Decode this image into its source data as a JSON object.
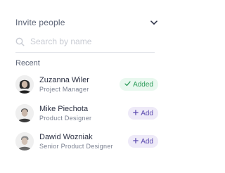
{
  "header": {
    "title": "Invite people",
    "toggle_icon": "chevron-down-icon"
  },
  "search": {
    "placeholder": "Search by name",
    "value": "",
    "icon": "search-icon"
  },
  "recent": {
    "label": "Recent",
    "people": [
      {
        "name": "Zuzanna Wiler",
        "role": "Project Manager",
        "action": "Added",
        "action_icon": "check-icon",
        "state": "added"
      },
      {
        "name": "Mike Piechota",
        "role": "Product Designer",
        "action": "Add",
        "action_icon": "plus-icon",
        "state": "add"
      },
      {
        "name": "Dawid Wozniak",
        "role": "Senior Product Designer",
        "action": "Add",
        "action_icon": "plus-icon",
        "state": "add"
      }
    ]
  },
  "colors": {
    "added_bg": "#e9f8ef",
    "added_text": "#2e9c5a",
    "add_bg": "#eeeaf8",
    "add_text": "#5c4bb0"
  }
}
